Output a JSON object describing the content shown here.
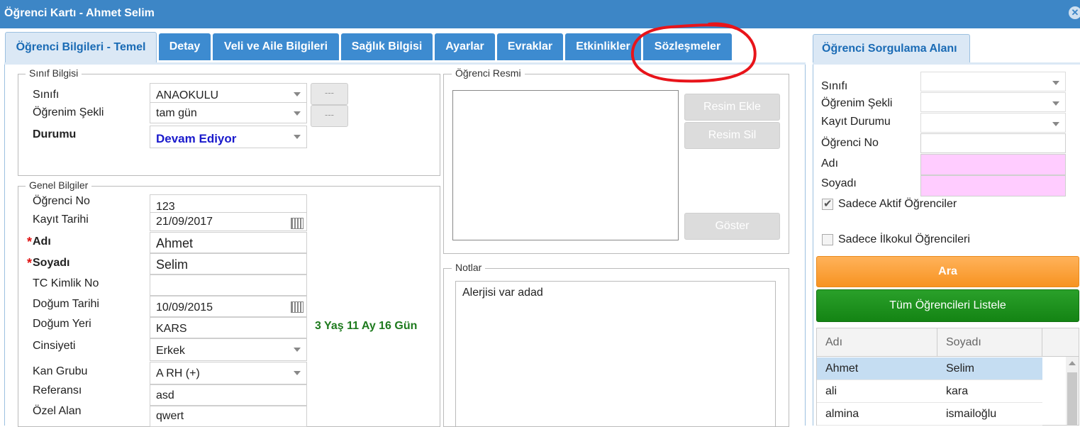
{
  "window": {
    "title": "Öğrenci Kartı - Ahmet Selim",
    "close_icon": "close-icon"
  },
  "tabs": [
    {
      "label": "Öğrenci Bilgileri - Temel"
    },
    {
      "label": "Detay"
    },
    {
      "label": "Veli ve Aile Bilgileri"
    },
    {
      "label": "Sağlık Bilgisi"
    },
    {
      "label": "Ayarlar"
    },
    {
      "label": "Evraklar"
    },
    {
      "label": "Etkinlikler"
    },
    {
      "label": "Sözleşmeler"
    }
  ],
  "sinif": {
    "legend": "Sınıf Bilgisi",
    "sinifi_label": "Sınıfı",
    "sinifi_value": "ANAOKULU",
    "ogrenim_label": "Öğrenim Şekli",
    "ogrenim_value": "tam gün",
    "durum_label": "Durumu",
    "durum_value": "Devam Ediyor",
    "btn1": "---",
    "btn2": "---"
  },
  "genel": {
    "legend": "Genel Bilgiler",
    "ogrno_label": "Öğrenci No",
    "ogrno_value": "123",
    "kayit_label": "Kayıt Tarihi",
    "kayit_value": "21/09/2017",
    "adi_label": "Adı",
    "adi_value": "Ahmet",
    "soyadi_label": "Soyadı",
    "soyadi_value": "Selim",
    "tc_label": "TC Kimlik No",
    "tc_value": "",
    "dogum_label": "Doğum Tarihi",
    "dogum_value": "10/09/2015",
    "dogumyeri_label": "Doğum Yeri",
    "dogumyeri_value": "KARS",
    "age": "3 Yaş 11 Ay 16 Gün",
    "cins_label": "Cinsiyeti",
    "cins_value": "Erkek",
    "kan_label": "Kan Grubu",
    "kan_value": "A RH (+)",
    "ref_label": "Referansı",
    "ref_value": "asd",
    "ozel_label": "Özel Alan",
    "ozel_value": "qwert",
    "required_mark": "*"
  },
  "resim": {
    "legend": "Öğrenci Resmi",
    "ekle": "Resim Ekle",
    "sil": "Resim Sil",
    "goster": "Göster"
  },
  "notlar": {
    "legend": "Notlar",
    "text": "Alerjisi var adad"
  },
  "sorgu": {
    "tab": "Öğrenci Sorgulama Alanı",
    "sinifi": "Sınıfı",
    "ogrenim": "Öğrenim Şekli",
    "kayit": "Kayıt Durumu",
    "ogrno": "Öğrenci No",
    "adi": "Adı",
    "soyadi": "Soyadı",
    "aktif": "Sadece Aktif Öğrenciler",
    "aktif_checked": true,
    "ilkokul": "Sadece İlkokul Öğrencileri",
    "ilkokul_checked": false,
    "ara": "Ara",
    "listele": "Tüm Öğrencileri Listele",
    "col_adi": "Adı",
    "col_soyadi": "Soyadı",
    "rows": [
      {
        "adi": "Ahmet",
        "soyadi": "Selim"
      },
      {
        "adi": "ali",
        "soyadi": "kara"
      },
      {
        "adi": "almina",
        "soyadi": "ismailoğlu"
      }
    ]
  },
  "colors": {
    "accent": "#3d86c6",
    "annotation": "#e8141a",
    "ara": "#f79321",
    "listele": "#1a8f1a",
    "pink_field": "#ffccff",
    "age": "#1e7a1e",
    "status": "#1a1acc"
  }
}
